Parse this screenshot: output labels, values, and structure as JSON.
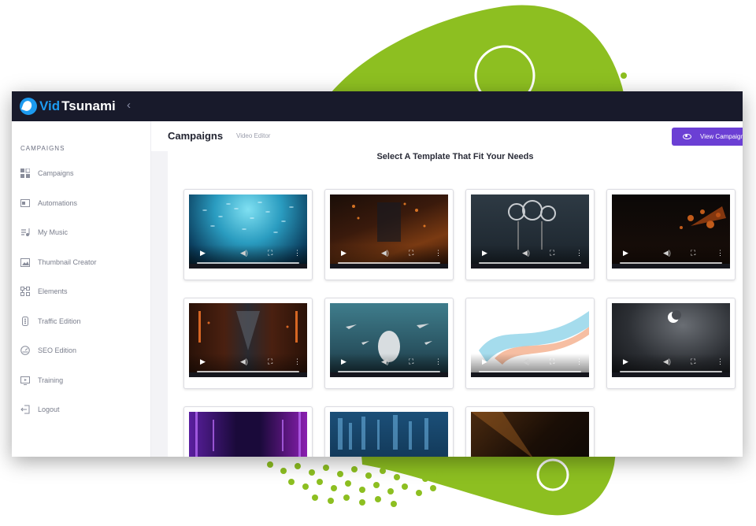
{
  "app": {
    "brand_part1": "Vid",
    "brand_part2": "Tsunami"
  },
  "sidebar": {
    "heading": "CAMPAIGNS",
    "items": [
      {
        "label": "Campaigns",
        "icon": "grid-icon"
      },
      {
        "label": "Automations",
        "icon": "automation-icon"
      },
      {
        "label": "My Music",
        "icon": "music-icon"
      },
      {
        "label": "Thumbnail Creator",
        "icon": "image-icon"
      },
      {
        "label": "Elements",
        "icon": "elements-icon"
      },
      {
        "label": "Traffic Edition",
        "icon": "traffic-icon"
      },
      {
        "label": "SEO Edition",
        "icon": "seo-icon"
      },
      {
        "label": "Training",
        "icon": "training-icon"
      },
      {
        "label": "Logout",
        "icon": "logout-icon"
      }
    ]
  },
  "header": {
    "title": "Campaigns",
    "subtitle": "Video Editor",
    "view_button": "View Campaign"
  },
  "panel": {
    "title": "Select A Template That Fit Your Needs"
  },
  "templates": [
    {
      "theme": "underwater fish school"
    },
    {
      "theme": "dark orange cityscape"
    },
    {
      "theme": "metal rings sculpture"
    },
    {
      "theme": "bokeh orange lights"
    },
    {
      "theme": "futuristic corridor"
    },
    {
      "theme": "space ships over planet"
    },
    {
      "theme": "abstract ribbon wave"
    },
    {
      "theme": "night moon clouds"
    },
    {
      "theme": "neon purple tunnel"
    },
    {
      "theme": "digital blue data city"
    },
    {
      "theme": "dark orange light rays"
    }
  ],
  "colors": {
    "topbar": "#181a2b",
    "accent": "#6b3fd4",
    "brand_blue": "#1d9bf0",
    "blob_green": "#8dbf21"
  }
}
